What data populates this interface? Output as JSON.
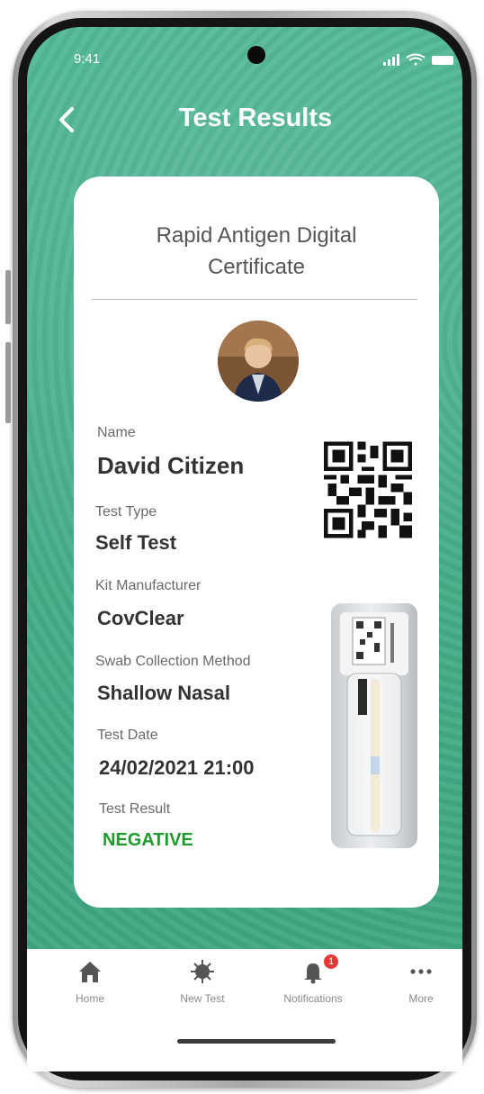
{
  "status_bar": {
    "time": "9:41"
  },
  "header": {
    "title": "Test Results"
  },
  "certificate": {
    "title_line1": "Rapid Antigen Digital",
    "title_line2": "Certificate",
    "fields": {
      "name_label": "Name",
      "name_value": "David Citizen",
      "test_type_label": "Test Type",
      "test_type_value": "Self Test",
      "kit_label": "Kit Manufacturer",
      "kit_value": "CovClear",
      "swab_label": "Swab Collection Method",
      "swab_value": "Shallow Nasal",
      "date_label": "Test Date",
      "date_value": "24/02/2021 21:00",
      "result_label": "Test Result",
      "result_value": "NEGATIVE"
    }
  },
  "bottom_nav": {
    "items": [
      {
        "label": "Home",
        "icon": "home-icon"
      },
      {
        "label": "New Test",
        "icon": "virus-icon"
      },
      {
        "label": "Notifications",
        "icon": "bell-icon",
        "badge": "1"
      },
      {
        "label": "More",
        "icon": "more-icon"
      }
    ]
  },
  "colors": {
    "background_green": "#46ad88",
    "result_green": "#1f9a2b",
    "badge_red": "#e53935"
  }
}
